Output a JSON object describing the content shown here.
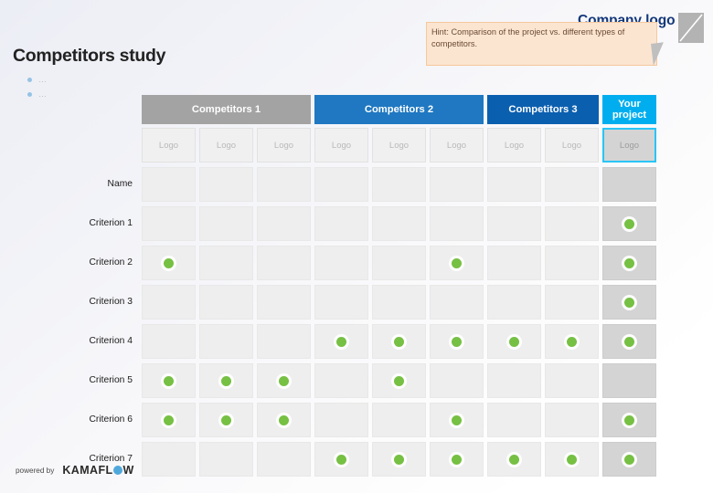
{
  "slide": {
    "title": "Competitors study",
    "company_logo_label": "Company logo",
    "logo_placeholder_icon": "image-placeholder-icon"
  },
  "hint": {
    "text": "Hint: Comparison of the project vs. different types of competitors."
  },
  "bullets": [
    {
      "text": "…"
    },
    {
      "text": "…"
    }
  ],
  "matrix": {
    "groups": [
      {
        "label": "Competitors 1",
        "color": "#a3a3a3",
        "span": 3,
        "style": "gray"
      },
      {
        "label": "Competitors 2",
        "color": "#1f78c1",
        "span": 3,
        "style": "blue"
      },
      {
        "label": "Competitors 3",
        "color": "#0b5faf",
        "span": 2,
        "style": "dblue"
      },
      {
        "label": "Your project",
        "color": "#00aeef",
        "span": 1,
        "style": "cyan"
      }
    ],
    "logo_label": "Logo",
    "logo_cells": [
      "Logo",
      "Logo",
      "Logo",
      "Logo",
      "Logo",
      "Logo",
      "Logo",
      "Logo",
      "Logo"
    ],
    "rows": [
      {
        "label": "Name",
        "dots": [
          false,
          false,
          false,
          false,
          false,
          false,
          false,
          false,
          false
        ]
      },
      {
        "label": "Criterion 1",
        "dots": [
          false,
          false,
          false,
          false,
          false,
          false,
          false,
          false,
          true
        ]
      },
      {
        "label": "Criterion 2",
        "dots": [
          true,
          false,
          false,
          false,
          false,
          true,
          false,
          false,
          true
        ]
      },
      {
        "label": "Criterion 3",
        "dots": [
          false,
          false,
          false,
          false,
          false,
          false,
          false,
          false,
          true
        ]
      },
      {
        "label": "Criterion 4",
        "dots": [
          false,
          false,
          false,
          true,
          true,
          true,
          true,
          true,
          true
        ]
      },
      {
        "label": "Criterion 5",
        "dots": [
          true,
          true,
          true,
          false,
          true,
          false,
          false,
          false,
          false
        ]
      },
      {
        "label": "Criterion 6",
        "dots": [
          true,
          true,
          true,
          false,
          false,
          true,
          false,
          false,
          true
        ]
      },
      {
        "label": "Criterion 7",
        "dots": [
          false,
          false,
          false,
          true,
          true,
          true,
          true,
          true,
          true
        ]
      }
    ],
    "dot_color": "#76c043",
    "columns": 9
  },
  "footer": {
    "powered_by": "powered by",
    "brand_part1": "KAMAFL",
    "brand_part2": "W",
    "brand_full": "KAMAFLOW"
  }
}
